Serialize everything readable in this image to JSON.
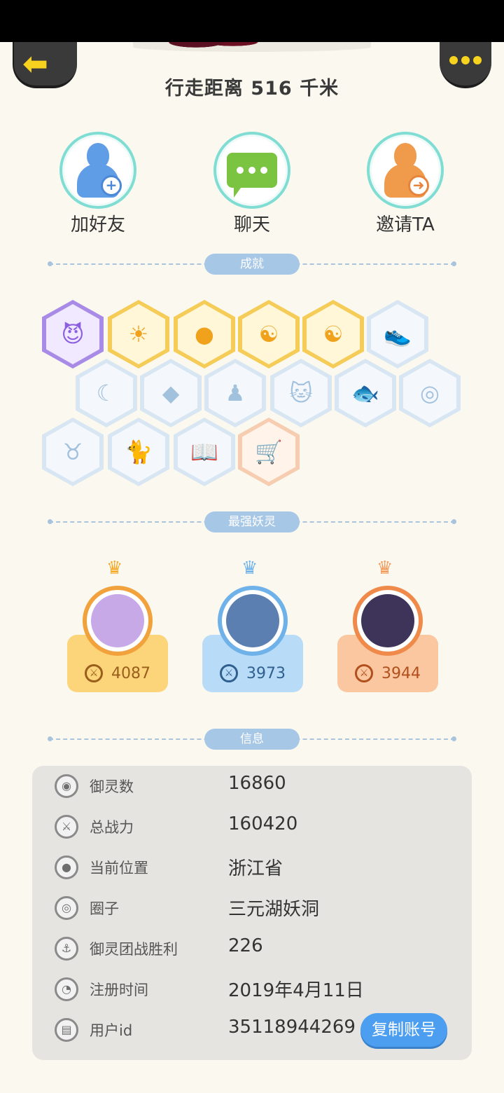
{
  "header": {
    "back_label": "back",
    "more_label": "more",
    "distance": "行走距离 516 千米"
  },
  "actions": [
    {
      "label": "加好友",
      "icon": "add-friend-icon",
      "color": "#5f9ee6"
    },
    {
      "label": "聊天",
      "icon": "chat-icon",
      "color": "#7bc441"
    },
    {
      "label": "邀请TA",
      "icon": "invite-icon",
      "color": "#f09a4c"
    }
  ],
  "sections": {
    "achievements": "成就",
    "strongest": "最强妖灵",
    "info": "信息"
  },
  "achievements": [
    {
      "style": "purple",
      "icon": "demon-face-icon"
    },
    {
      "style": "gold",
      "icon": "sun-compass-icon"
    },
    {
      "style": "gold",
      "icon": "golden-egg-icon"
    },
    {
      "style": "gold",
      "icon": "yin-yang-comet-icon"
    },
    {
      "style": "gold",
      "icon": "yin-yang-box-icon"
    },
    {
      "style": "pale",
      "icon": "sneaker-icon"
    },
    {
      "style": "pale",
      "icon": "moon-icon"
    },
    {
      "style": "pale",
      "icon": "crystal-icon"
    },
    {
      "style": "pale",
      "icon": "spirit-figure-icon"
    },
    {
      "style": "pale",
      "icon": "cat-spirit-icon"
    },
    {
      "style": "pale",
      "icon": "fish-icon"
    },
    {
      "style": "pale",
      "icon": "shield-icon"
    },
    {
      "style": "pale",
      "icon": "horned-beast-icon"
    },
    {
      "style": "pale",
      "icon": "cat-statue-icon"
    },
    {
      "style": "pale",
      "icon": "fox-book-icon"
    },
    {
      "style": "peach",
      "icon": "cat-cart-icon"
    }
  ],
  "spirits": [
    {
      "score": "4087",
      "avatar": "goddess-avatar",
      "crown": "gold-crown-icon"
    },
    {
      "score": "3973",
      "avatar": "spiky-beast-avatar",
      "crown": "blue-crown-icon"
    },
    {
      "score": "3944",
      "avatar": "fox-girl-avatar",
      "crown": "orange-crown-icon"
    }
  ],
  "info": {
    "rows": [
      {
        "key": "御灵数",
        "value": "16860",
        "icon": "spirit-count-icon"
      },
      {
        "key": "总战力",
        "value": "160420",
        "icon": "sword-icon"
      },
      {
        "key": "当前位置",
        "value": "浙江省",
        "icon": "location-pin-icon"
      },
      {
        "key": "圈子",
        "value": "三元湖妖洞",
        "icon": "circle-icon"
      },
      {
        "key": "御灵团战胜利",
        "value": "226",
        "icon": "anchor-icon"
      },
      {
        "key": "注册时间",
        "value": "2019年4月11日",
        "icon": "clock-icon"
      },
      {
        "key": "用户id",
        "value": "35118944269",
        "icon": "id-card-icon"
      }
    ],
    "copy_button": "复制账号"
  }
}
